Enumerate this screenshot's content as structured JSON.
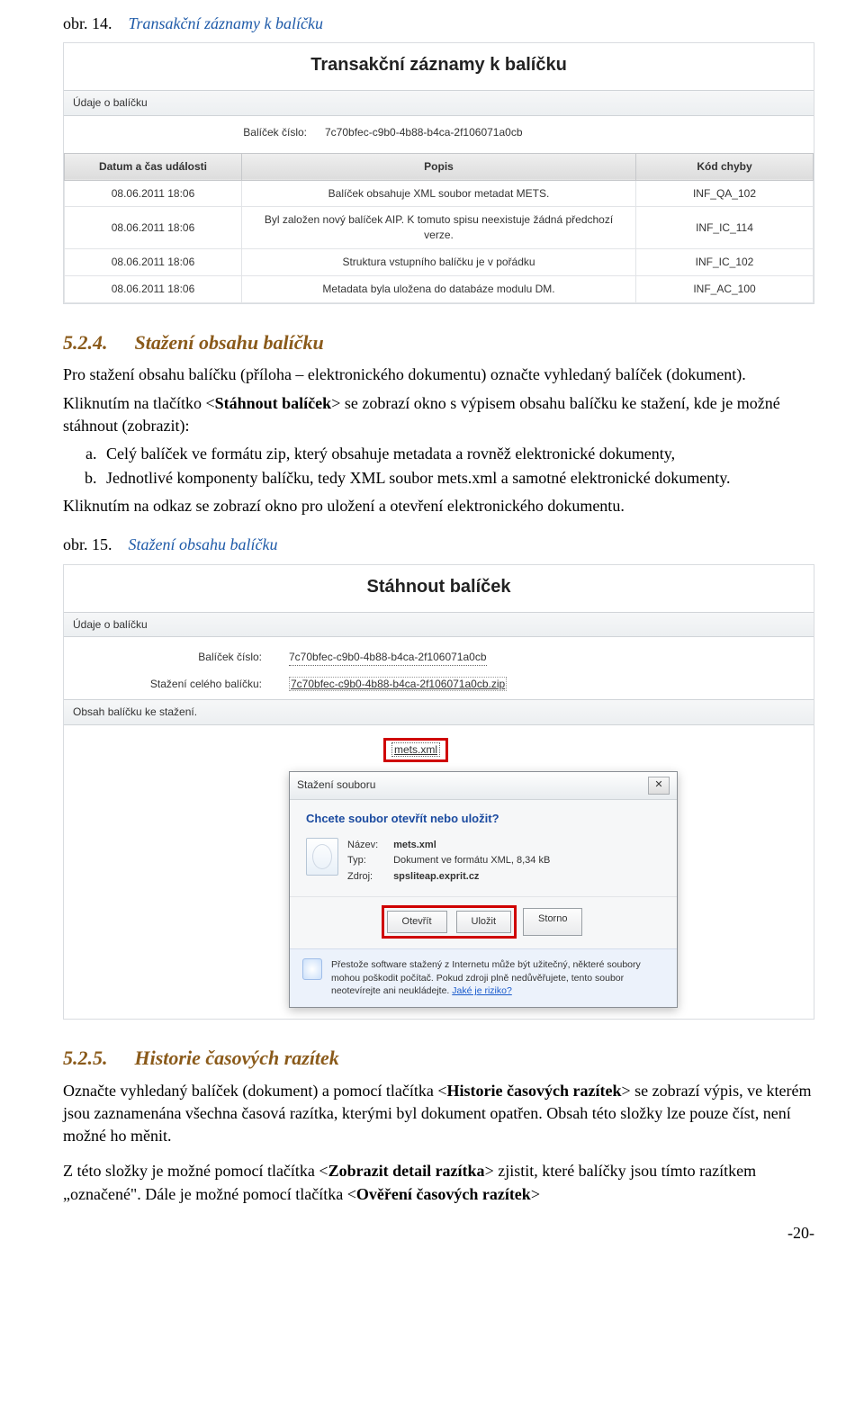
{
  "caption1": {
    "prefix": "obr. 14.",
    "title": "Transakční záznamy k balíčku"
  },
  "panel1": {
    "title": "Transakční záznamy k balíčku",
    "section": "Údaje o balíčku",
    "pkgLabel": "Balíček číslo:",
    "pkgValue": "7c70bfec-c9b0-4b88-b4ca-2f106071a0cb",
    "headers": {
      "c1": "Datum a čas události",
      "c2": "Popis",
      "c3": "Kód chyby"
    },
    "rows": [
      {
        "c1": "08.06.2011 18:06",
        "c2": "Balíček obsahuje XML soubor metadat METS.",
        "c3": "INF_QA_102"
      },
      {
        "c1": "08.06.2011 18:06",
        "c2": "Byl založen nový balíček AIP. K tomuto spisu neexistuje žádná předchozí verze.",
        "c3": "INF_IC_114"
      },
      {
        "c1": "08.06.2011 18:06",
        "c2": "Struktura vstupního balíčku je v pořádku",
        "c3": "INF_IC_102"
      },
      {
        "c1": "08.06.2011 18:06",
        "c2": "Metadata byla uložena do databáze modulu DM.",
        "c3": "INF_AC_100"
      }
    ]
  },
  "sec524": {
    "num": "5.2.4.",
    "title": "Stažení obsahu balíčku",
    "p1": "Pro stažení obsahu balíčku (příloha – elektronického dokumentu) označte vyhledaný balíček (dokument).",
    "p2a": "Kliknutím na tlačítko <",
    "p2b": "Stáhnout balíček",
    "p2c": "> se zobrazí okno s výpisem obsahu balíčku ke stažení, kde je možné stáhnout (zobrazit):",
    "liA": "Celý balíček ve formátu zip, který obsahuje metadata a rovněž elektronické dokumenty,",
    "liB": "Jednotlivé komponenty balíčku, tedy XML soubor mets.xml a samotné elektronické dokumenty.",
    "p3": "Kliknutím na odkaz se zobrazí okno pro uložení a otevření elektronického dokumentu."
  },
  "caption2": {
    "prefix": "obr. 15.",
    "title": "Stažení obsahu balíčku"
  },
  "panel2": {
    "title": "Stáhnout balíček",
    "section1": "Údaje o balíčku",
    "pkgLabel": "Balíček číslo:",
    "pkgValue": "7c70bfec-c9b0-4b88-b4ca-2f106071a0cb",
    "dlLabel": "Stažení celého balíčku:",
    "dlValue": "7c70bfec-c9b0-4b88-b4ca-2f106071a0cb.zip",
    "section2": "Obsah balíčku ke stažení.",
    "mets": "mets.xml"
  },
  "dlg": {
    "title": "Stažení souboru",
    "prompt": "Chcete soubor otevřít nebo uložit?",
    "nameL": "Název:",
    "nameV": "mets.xml",
    "typeL": "Typ:",
    "typeV": "Dokument ve formátu XML, 8,34 kB",
    "srcL": "Zdroj:",
    "srcV": "spsliteap.exprit.cz",
    "btnOpen": "Otevřít",
    "btnSave": "Uložit",
    "btnCancel": "Storno",
    "warn": "Přestože software stažený z Internetu může být užitečný, některé soubory mohou poškodit počítač. Pokud zdroji plně nedůvěřujete, tento soubor neotevírejte ani neukládejte.",
    "risk": "Jaké je riziko?"
  },
  "sec525": {
    "num": "5.2.5.",
    "title": "Historie časových razítek",
    "p1a": "Označte vyhledaný balíček (dokument) a pomocí tlačítka <",
    "p1b": "Historie časových razítek",
    "p1c": "> se zobrazí výpis, ve kterém jsou zaznamenána všechna časová razítka, kterými byl dokument opatřen. Obsah této složky lze pouze číst, není možné ho měnit.",
    "p2a": "Z této složky je možné pomocí tlačítka <",
    "p2b": "Zobrazit detail razítka",
    "p2c": "> zjistit, které balíčky jsou tímto razítkem „označené\". Dále je možné pomocí tlačítka <",
    "p2d": "Ověření časových razítek",
    "p2e": ">"
  },
  "pageNumber": "-20-"
}
